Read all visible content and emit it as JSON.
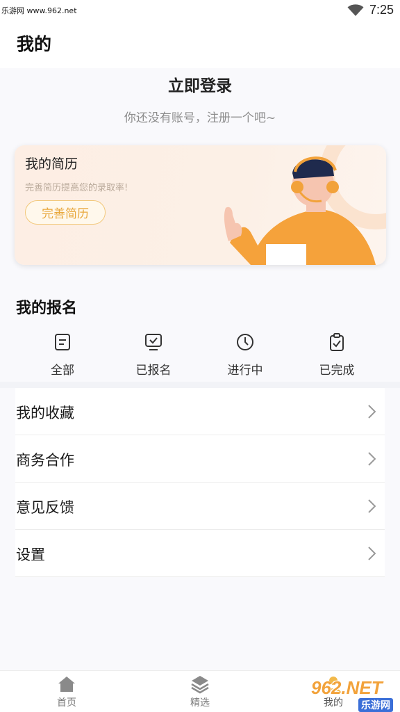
{
  "status_bar": {
    "watermark": "乐游网 www.962.net",
    "time": "7:25"
  },
  "header": {
    "title": "我的"
  },
  "login": {
    "title": "立即登录",
    "subtitle": "你还没有账号，注册一个吧~"
  },
  "resume_card": {
    "title": "我的简历",
    "description": "完善简历提高您的录取率!",
    "button_label": "完善简历"
  },
  "registration": {
    "title": "我的报名",
    "items": [
      {
        "label": "全部",
        "icon": "list-doc-icon"
      },
      {
        "label": "已报名",
        "icon": "monitor-check-icon"
      },
      {
        "label": "进行中",
        "icon": "clock-icon"
      },
      {
        "label": "已完成",
        "icon": "clipboard-check-icon"
      }
    ]
  },
  "menu": {
    "items": [
      {
        "label": "我的收藏"
      },
      {
        "label": "商务合作"
      },
      {
        "label": "意见反馈"
      },
      {
        "label": "设置"
      }
    ]
  },
  "bottom_nav": {
    "items": [
      {
        "label": "首页",
        "icon": "home-icon"
      },
      {
        "label": "精选",
        "icon": "layers-icon"
      },
      {
        "label": "我的",
        "icon": "user-icon"
      }
    ]
  },
  "watermark_logo": {
    "brand": "962.NET",
    "sub": "乐游网"
  },
  "colors": {
    "accent": "#f2a23a",
    "resume_button_text": "#e8a73b",
    "background": "#f9f9fc"
  }
}
